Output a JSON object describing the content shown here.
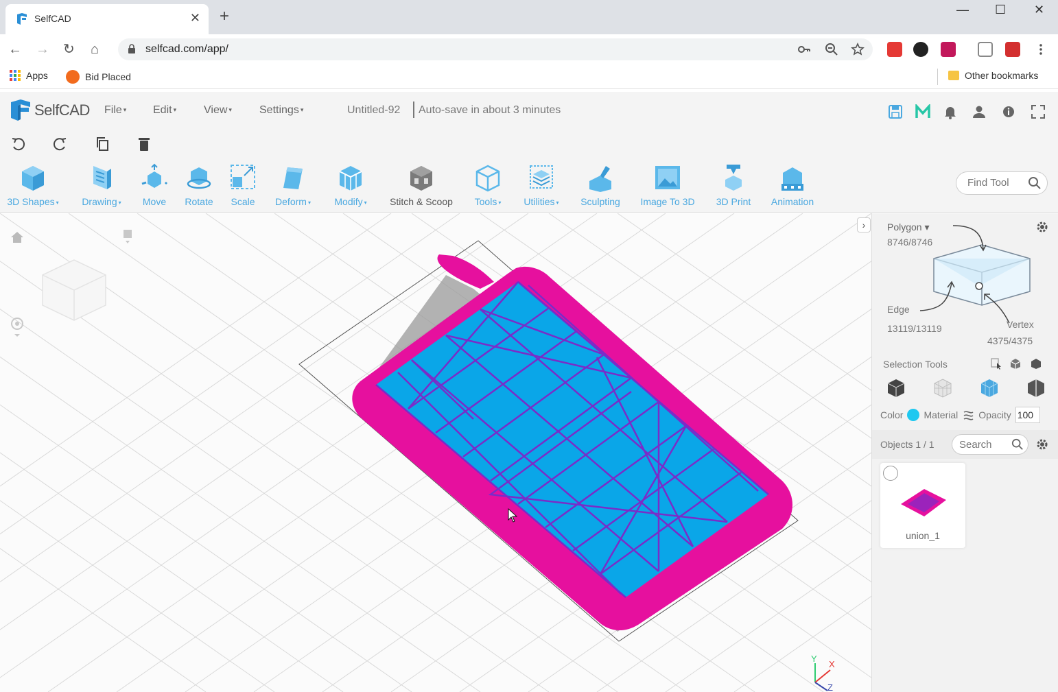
{
  "browser": {
    "tab_title": "SelfCAD",
    "tab_close": "✕",
    "new_tab": "+",
    "url": "selfcad.com/app/",
    "window_controls": {
      "minimize": "—",
      "maximize": "☐",
      "close": "✕"
    },
    "nav": {
      "back": "←",
      "forward": "→",
      "reload": "↻",
      "home": "⌂"
    },
    "bookmarks": [
      {
        "label": "Apps"
      },
      {
        "label": "Bid Placed"
      }
    ],
    "other_bookmarks": "Other bookmarks"
  },
  "app": {
    "logo_text": "SelfCAD",
    "menus": [
      {
        "label": "File"
      },
      {
        "label": "Edit"
      },
      {
        "label": "View"
      },
      {
        "label": "Settings"
      }
    ],
    "caret": "▾",
    "document_title": "Untitled-92",
    "autosave": "Auto-save in about 3 minutes"
  },
  "toolbar": {
    "tools": [
      {
        "label": "3D Shapes",
        "dropdown": true
      },
      {
        "label": "Drawing",
        "dropdown": true
      },
      {
        "label": "Move",
        "dropdown": false
      },
      {
        "label": "Rotate",
        "dropdown": false
      },
      {
        "label": "Scale",
        "dropdown": false
      },
      {
        "label": "Deform",
        "dropdown": true
      },
      {
        "label": "Modify",
        "dropdown": true
      },
      {
        "label": "Stitch & Scoop",
        "dropdown": false
      },
      {
        "label": "Tools",
        "dropdown": true
      },
      {
        "label": "Utilities",
        "dropdown": true
      },
      {
        "label": "Sculpting",
        "dropdown": false
      },
      {
        "label": "Image To 3D",
        "dropdown": false
      },
      {
        "label": "3D Print",
        "dropdown": false
      },
      {
        "label": "Animation",
        "dropdown": false
      }
    ],
    "find_tool_placeholder": "Find Tool"
  },
  "panel": {
    "polygon_label": "Polygon ▾",
    "polygon_count": "8746/8746",
    "edge_label": "Edge",
    "edge_count": "13119/13119",
    "vertex_label": "Vertex",
    "vertex_count": "4375/4375",
    "selection_tools": "Selection Tools",
    "color_label": "Color",
    "material_label": "Material",
    "opacity_label": "Opacity",
    "opacity_value": "100",
    "objects_label": "Objects 1 / 1",
    "search_placeholder": "Search",
    "object_name": "union_1"
  },
  "axes": {
    "x": "X",
    "y": "Y",
    "z": "Z"
  },
  "colors": {
    "accent": "#4aa8e0",
    "model_magenta": "#e6109e",
    "model_blue": "#0aa6e8",
    "wire": "#7a2cc8",
    "color_swatch": "#1ec8f0"
  }
}
